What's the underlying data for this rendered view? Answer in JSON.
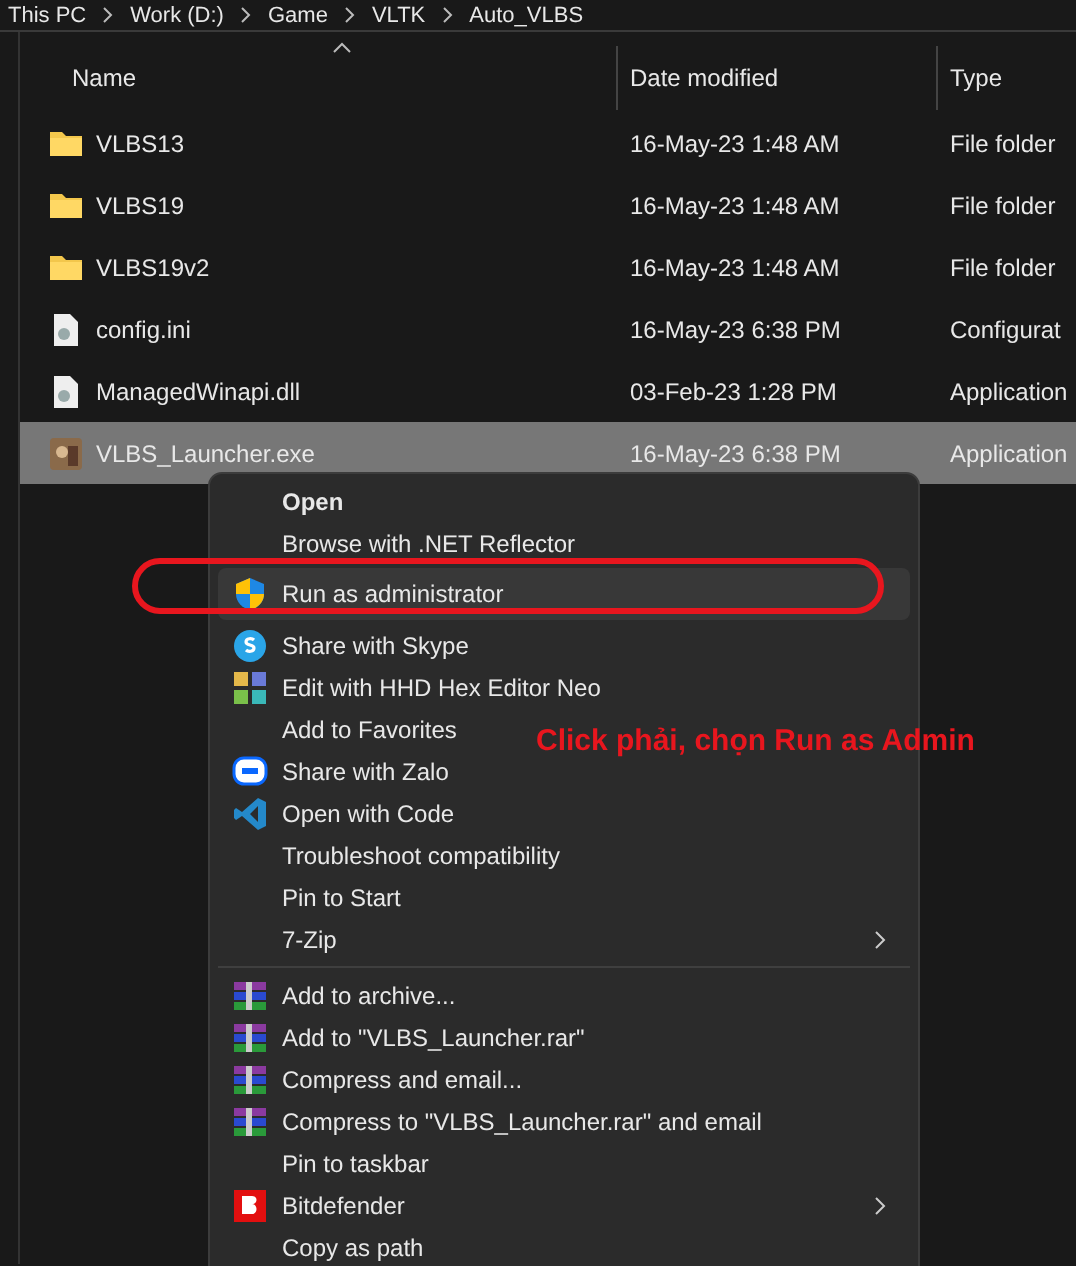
{
  "breadcrumb": [
    "This PC",
    "Work (D:)",
    "Game",
    "VLTK",
    "Auto_VLBS"
  ],
  "columns": [
    {
      "label": "Name",
      "sorted": true
    },
    {
      "label": "Date modified",
      "sorted": false
    },
    {
      "label": "Type",
      "sorted": false
    }
  ],
  "files": [
    {
      "name": "VLBS13",
      "date": "16-May-23 1:48 AM",
      "type": "File folder",
      "kind": "folder",
      "selected": false
    },
    {
      "name": "VLBS19",
      "date": "16-May-23 1:48 AM",
      "type": "File folder",
      "kind": "folder",
      "selected": false
    },
    {
      "name": "VLBS19v2",
      "date": "16-May-23 1:48 AM",
      "type": "File folder",
      "kind": "folder",
      "selected": false
    },
    {
      "name": "config.ini",
      "date": "16-May-23 6:38 PM",
      "type": "Configurat",
      "kind": "settings",
      "selected": false
    },
    {
      "name": "ManagedWinapi.dll",
      "date": "03-Feb-23 1:28 PM",
      "type": "Application",
      "kind": "settings",
      "selected": false
    },
    {
      "name": "VLBS_Launcher.exe",
      "date": "16-May-23 6:38 PM",
      "type": "Application",
      "kind": "app",
      "selected": true
    }
  ],
  "context_menu": [
    {
      "kind": "plain",
      "label": "Open",
      "bold": true,
      "highlighted": false,
      "submenu": false
    },
    {
      "kind": "plain",
      "label": "Browse with .NET Reflector",
      "bold": false,
      "highlighted": false,
      "submenu": false
    },
    {
      "kind": "shield",
      "label": "Run as administrator",
      "bold": false,
      "highlighted": true,
      "submenu": false
    },
    {
      "kind": "skype",
      "label": "Share with Skype",
      "bold": false,
      "highlighted": false,
      "submenu": false
    },
    {
      "kind": "hex",
      "label": "Edit with HHD Hex Editor Neo",
      "bold": false,
      "highlighted": false,
      "submenu": false
    },
    {
      "kind": "plain",
      "label": "Add to Favorites",
      "bold": false,
      "highlighted": false,
      "submenu": false
    },
    {
      "kind": "zalo",
      "label": "Share with Zalo",
      "bold": false,
      "highlighted": false,
      "submenu": false
    },
    {
      "kind": "code",
      "label": "Open with Code",
      "bold": false,
      "highlighted": false,
      "submenu": false
    },
    {
      "kind": "plain",
      "label": "Troubleshoot compatibility",
      "bold": false,
      "highlighted": false,
      "submenu": false
    },
    {
      "kind": "plain",
      "label": "Pin to Start",
      "bold": false,
      "highlighted": false,
      "submenu": false
    },
    {
      "kind": "plain",
      "label": "7-Zip",
      "bold": false,
      "highlighted": false,
      "submenu": true
    },
    {
      "kind": "separator"
    },
    {
      "kind": "archive",
      "label": "Add to archive...",
      "bold": false,
      "highlighted": false,
      "submenu": false
    },
    {
      "kind": "archive",
      "label": "Add to \"VLBS_Launcher.rar\"",
      "bold": false,
      "highlighted": false,
      "submenu": false
    },
    {
      "kind": "archive",
      "label": "Compress and email...",
      "bold": false,
      "highlighted": false,
      "submenu": false
    },
    {
      "kind": "archive",
      "label": "Compress to \"VLBS_Launcher.rar\" and email",
      "bold": false,
      "highlighted": false,
      "submenu": false
    },
    {
      "kind": "plain",
      "label": "Pin to taskbar",
      "bold": false,
      "highlighted": false,
      "submenu": false
    },
    {
      "kind": "bitdefender",
      "label": "Bitdefender",
      "bold": false,
      "highlighted": false,
      "submenu": true
    },
    {
      "kind": "plain",
      "label": "Copy as path",
      "bold": false,
      "highlighted": false,
      "submenu": false
    }
  ],
  "annotation": {
    "text": "Click phải, chọn Run as Admin"
  }
}
